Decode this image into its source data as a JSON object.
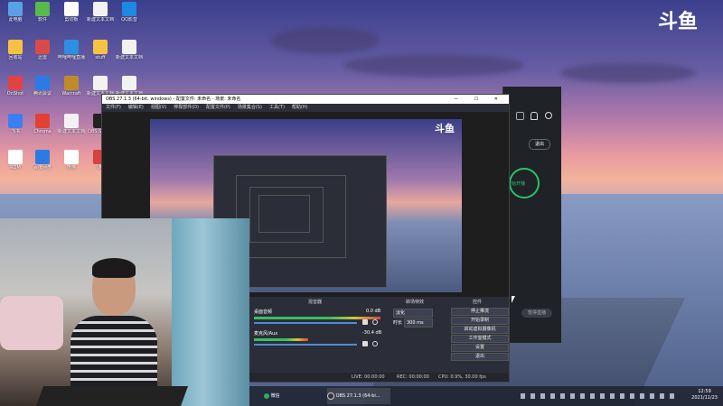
{
  "desktop": {
    "brand_logo": "斗鱼",
    "icons": [
      {
        "label": "此电脑",
        "color": "#5aa0e6",
        "icon": "computer-icon"
      },
      {
        "label": "软件",
        "color": "#58b94d",
        "icon": "app-icon"
      },
      {
        "label": "剪切板",
        "color": "#ffffff",
        "icon": "clipboard-icon"
      },
      {
        "label": "新建文本文档",
        "color": "#f2f2f2",
        "icon": "document-icon"
      },
      {
        "label": "QQ影音",
        "color": "#1e88e5",
        "icon": "player-icon"
      },
      {
        "label": "回收站",
        "color": "#f5c244",
        "icon": "folder-icon"
      },
      {
        "label": "迅雷",
        "color": "#d94a4a",
        "icon": "app-icon"
      },
      {
        "label": "哔哩哔哩直播姬",
        "color": "#2d8fe3",
        "icon": "app-icon"
      },
      {
        "label": "stuff",
        "color": "#f5c244",
        "icon": "folder-icon"
      },
      {
        "label": "新建文本文档",
        "color": "#f2f2f2",
        "icon": "document-icon"
      },
      {
        "label": "OnShot",
        "color": "#e04343",
        "icon": "app-icon"
      },
      {
        "label": "腾讯会议",
        "color": "#2c7be5",
        "icon": "app-icon"
      },
      {
        "label": "Warcraft",
        "color": "#c08a2a",
        "icon": "game-icon"
      },
      {
        "label": "新建文本文档",
        "color": "#f2f2f2",
        "icon": "document-icon"
      },
      {
        "label": "新建文本文档",
        "color": "#f2f2f2",
        "icon": "document-icon"
      },
      {
        "label": "飞书",
        "color": "#3b7ff2",
        "icon": "app-icon"
      },
      {
        "label": "Chrome",
        "color": "#e34133",
        "icon": "chrome-icon"
      },
      {
        "label": "新建文本文档",
        "color": "#f2f2f2",
        "icon": "document-icon"
      },
      {
        "label": "OBS Studio",
        "color": "#222222",
        "icon": "obs-icon"
      },
      {
        "label": "剪映",
        "color": "#111111",
        "icon": "app-icon"
      },
      {
        "label": "RDM",
        "color": "#ffffff",
        "icon": "app-icon"
      },
      {
        "label": "百度网盘",
        "color": "#2c7be5",
        "icon": "app-icon"
      },
      {
        "label": "熊猫",
        "color": "#ffffff",
        "icon": "panda-icon"
      },
      {
        "label": "UU",
        "color": "#d94040",
        "icon": "app-icon"
      },
      {
        "label": "Office",
        "color": "#e8742a",
        "icon": "office-icon"
      }
    ]
  },
  "obs": {
    "title": "OBS 27.1.3 (64-bit, windows) - 配置文件: 未命名 - 场景: 未命名",
    "menus": [
      "文件(F)",
      "编辑(E)",
      "视图(V)",
      "停靠部件(D)",
      "配置文件(P)",
      "场景集合(S)",
      "工具(T)",
      "帮助(H)"
    ],
    "window_controls": "— ☐ ✕",
    "preview_logo": "斗鱼",
    "docks": {
      "mixer_title": "混音器",
      "transition_title": "转场特效",
      "controls_title": "控件",
      "desktop_audio": "桌面音频",
      "desktop_audio_level": "0.0 dB",
      "mic_audio": "麦克风/Aux",
      "mic_audio_level": "-30.4 dB",
      "transition_type": "淡化",
      "duration_label": "时长",
      "duration_value": "300 ms",
      "buttons": [
        "停止推流",
        "开始录制",
        "启动虚拟摄像机",
        "工作室模式",
        "设置",
        "退出"
      ]
    },
    "status": {
      "live": "LIVE: 00:00:00",
      "rec": "REC: 00:00:00",
      "cpu": "CPU: 0.9%, 30.00 fps"
    }
  },
  "right_panel": {
    "exit_button": "退出",
    "start_label": "开始开播",
    "footer_button": "暂停直播"
  },
  "taskbar": {
    "items": [
      {
        "label": "微信",
        "icon": "wechat-icon"
      },
      {
        "label": "OBS 27.1.3 (64-bi...",
        "icon": "obs-icon"
      }
    ],
    "time": "12:59",
    "date": "2021/11/23"
  }
}
